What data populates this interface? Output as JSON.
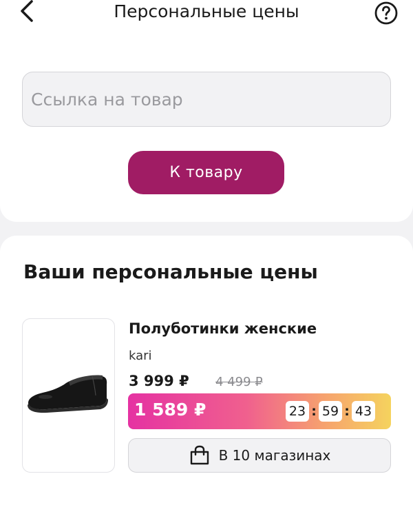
{
  "header": {
    "title": "Персональные цены",
    "back_icon": "chevron-left-icon",
    "help_icon": "question-circle-icon"
  },
  "link_form": {
    "placeholder": "Ссылка на товар",
    "value": "",
    "button_label": "К товару"
  },
  "prices_section": {
    "title": "Ваши персональные цены",
    "products": [
      {
        "name": "Полуботинки женские",
        "brand": "kari",
        "price": "3 999 ₽",
        "old_price": "4 499 ₽",
        "personal_price": "1 589 ₽",
        "timer": {
          "hours": "23",
          "minutes": "59",
          "seconds": "43"
        },
        "stores_label": "В 10 магазинах",
        "stores_icon": "shopping-bag-icon",
        "image_icon": "shoe-image"
      }
    ]
  },
  "colors": {
    "accent": "#a01c64",
    "promo_gradient": [
      "#e532a2",
      "#f0608e",
      "#f6a36e",
      "#f5d35e"
    ],
    "background": "#f2f2f4"
  }
}
